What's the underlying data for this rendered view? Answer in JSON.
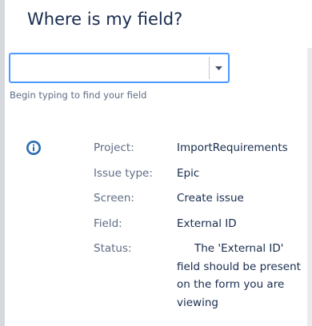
{
  "dialog": {
    "title": "Where is my field?",
    "search": {
      "value": "",
      "placeholder": "",
      "hint": "Begin typing to find your field"
    },
    "details": {
      "project_label": "Project:",
      "project_value": "ImportRequirements",
      "issue_type_label": "Issue type:",
      "issue_type_value": "Epic",
      "screen_label": "Screen:",
      "screen_value": "Create issue",
      "field_label": "Field:",
      "field_value": "External ID",
      "status_label": "Status:",
      "status_value": "The 'External ID' field should be present on the form you are viewing"
    }
  },
  "icons": {
    "info": "info-icon",
    "dropdown": "chevron-down-icon"
  },
  "colors": {
    "focus_border": "#4c9aff",
    "info_icon": "#2b6cb0",
    "title_text": "#172b4d",
    "label_text": "#5e6c84"
  }
}
